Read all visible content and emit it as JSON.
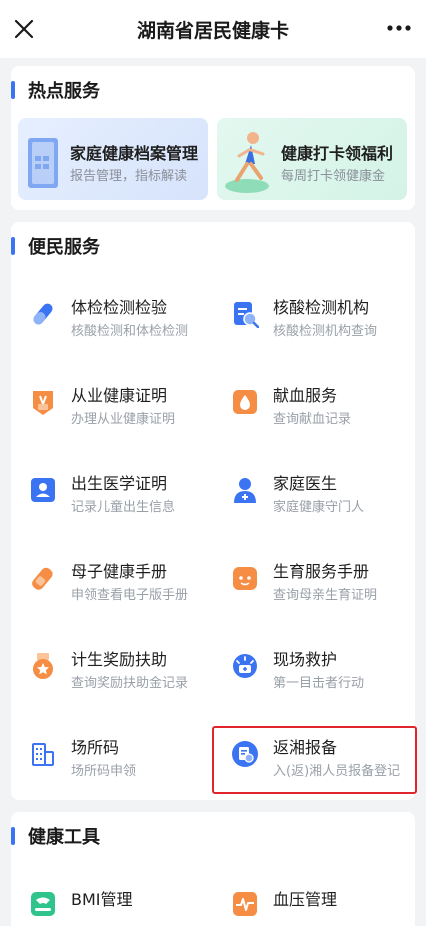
{
  "header": {
    "title": "湖南省居民健康卡",
    "close_icon": "close-icon",
    "more_icon": "more-icon"
  },
  "hot": {
    "title": "热点服务",
    "items": [
      {
        "title": "家庭健康档案管理",
        "subtitle": "报告管理，指标解读"
      },
      {
        "title": "健康打卡领福利",
        "subtitle": "每周打卡领健康金"
      }
    ]
  },
  "convenience": {
    "title": "便民服务",
    "items": [
      {
        "name": "体检检测检验",
        "desc": "核酸检测和体检检测",
        "icon": "test-tube-icon"
      },
      {
        "name": "核酸检测机构",
        "desc": "核酸检测机构查询",
        "icon": "report-search-icon"
      },
      {
        "name": "从业健康证明",
        "desc": "办理从业健康证明",
        "icon": "certificate-icon"
      },
      {
        "name": "献血服务",
        "desc": "查询献血记录",
        "icon": "blood-drop-icon"
      },
      {
        "name": "出生医学证明",
        "desc": "记录儿童出生信息",
        "icon": "birth-certificate-icon"
      },
      {
        "name": "家庭医生",
        "desc": "家庭健康守门人",
        "icon": "doctor-icon"
      },
      {
        "name": "母子健康手册",
        "desc": "申领查看电子版手册",
        "icon": "baby-bottle-icon"
      },
      {
        "name": "生育服务手册",
        "desc": "查询母亲生育证明",
        "icon": "baby-face-icon"
      },
      {
        "name": "计生奖励扶助",
        "desc": "查询奖励扶助金记录",
        "icon": "award-icon"
      },
      {
        "name": "现场救护",
        "desc": "第一目击者行动",
        "icon": "aid-icon"
      },
      {
        "name": "场所码",
        "desc": "场所码申领",
        "icon": "building-icon"
      },
      {
        "name": "返湘报备",
        "desc": "入(返)湘人员报备登记",
        "icon": "return-report-icon"
      }
    ]
  },
  "tools": {
    "title": "健康工具",
    "items": [
      {
        "name": "BMI管理",
        "icon": "scale-icon"
      },
      {
        "name": "血压管理",
        "icon": "pulse-icon"
      }
    ]
  },
  "colors": {
    "accent": "#3b74f2",
    "orange": "#f58d45",
    "highlight": "#e0262a",
    "green": "#2ec48c"
  }
}
